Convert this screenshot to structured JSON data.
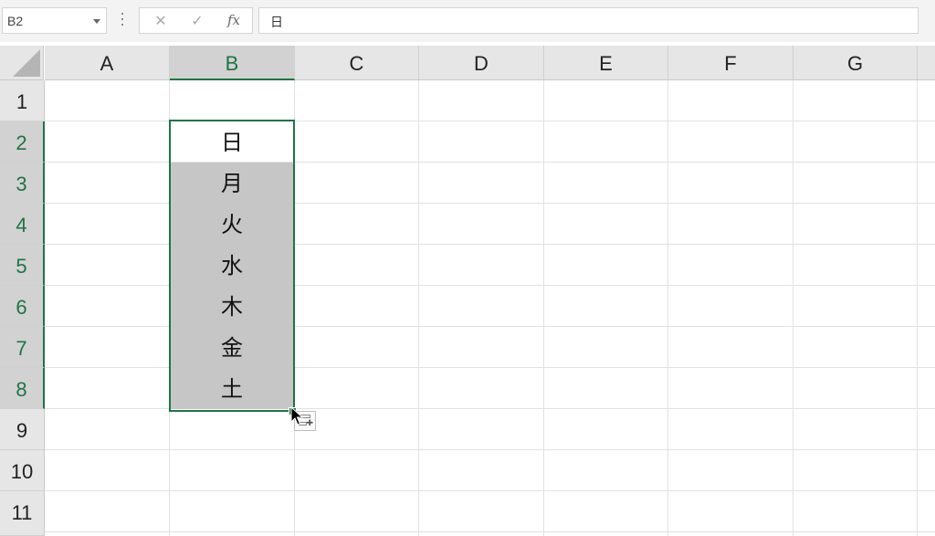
{
  "formula_bar": {
    "name_box": "B2",
    "cancel_icon": "cancel-x-icon",
    "enter_icon": "enter-check-icon",
    "fx_label": "fx",
    "formula": "日"
  },
  "columns": [
    "A",
    "B",
    "C",
    "D",
    "E",
    "F",
    "G"
  ],
  "rows": [
    "1",
    "2",
    "3",
    "4",
    "5",
    "6",
    "7",
    "8",
    "9",
    "10",
    "11"
  ],
  "selection": {
    "active_cell": "B2",
    "range": "B2:B8"
  },
  "column_b_values": [
    "日",
    "月",
    "火",
    "水",
    "木",
    "金",
    "土"
  ],
  "colors": {
    "accent": "#217346",
    "selection_fill": "#c6c6c6",
    "header_bg": "#e6e6e6"
  }
}
